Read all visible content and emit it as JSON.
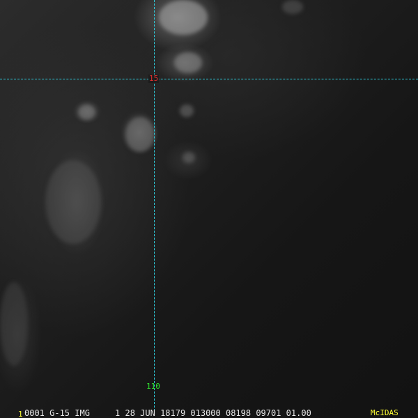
{
  "overlay": {
    "lat_line_label": "15",
    "lon_line_label": "110",
    "lat_label_color": "#e03030",
    "lon_label_color": "#30e030",
    "grid_color": "#2fd0e0"
  },
  "status_bar": {
    "frame_number": "1",
    "info_text": "0001 G-15 IMG     1 28 JUN 18179 013000 08198 09701 01.00",
    "logo_text": "McIDAS",
    "info_color": "#e8e8e8",
    "accent_color": "#ffff33"
  }
}
